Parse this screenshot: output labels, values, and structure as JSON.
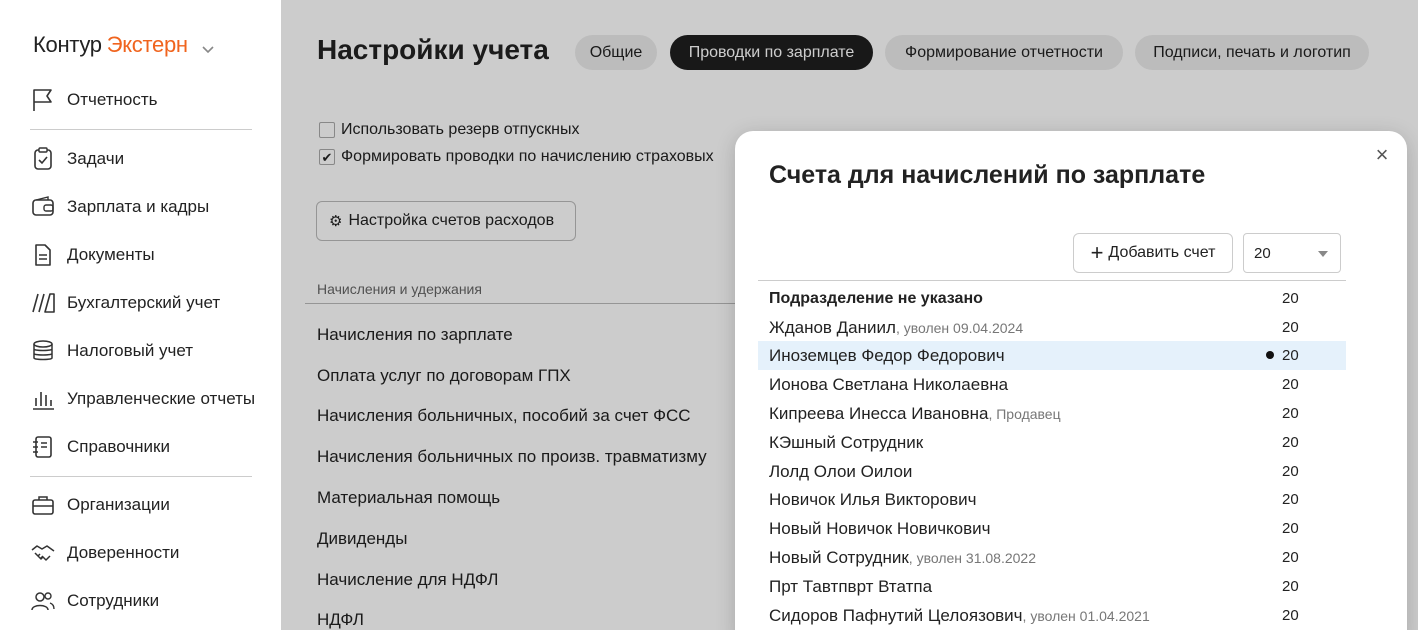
{
  "brand": {
    "part1": "Контур",
    "part2": "Экстерн"
  },
  "sidebar": {
    "items": [
      {
        "label": "Отчетность",
        "icon": "flag-icon"
      },
      {
        "label": "Задачи",
        "icon": "clipboard-check-icon"
      },
      {
        "label": "Зарплата и кадры",
        "icon": "wallet-icon"
      },
      {
        "label": "Документы",
        "icon": "document-icon"
      },
      {
        "label": "Бухгалтерский учет",
        "icon": "accounting-icon"
      },
      {
        "label": "Налоговый учет",
        "icon": "coins-icon"
      },
      {
        "label": "Управленческие отчеты",
        "icon": "bar-chart-icon"
      },
      {
        "label": "Справочники",
        "icon": "notebook-icon"
      },
      {
        "label": "Организации",
        "icon": "briefcase-icon"
      },
      {
        "label": "Доверенности",
        "icon": "handshake-icon"
      },
      {
        "label": "Сотрудники",
        "icon": "users-icon"
      }
    ]
  },
  "main": {
    "title": "Настройки учета",
    "tabs": [
      {
        "label": "Общие"
      },
      {
        "label": "Проводки по зарплате",
        "active": true
      },
      {
        "label": "Формирование отчетности"
      },
      {
        "label": "Подписи, печать и логотип"
      }
    ],
    "checkboxes": [
      {
        "label": "Использовать резерв отпускных",
        "checked": false
      },
      {
        "label": "Формировать проводки по начислению страховых",
        "checked": true
      }
    ],
    "settings_button": "Настройка счетов расходов",
    "column_header": "Начисления и удержания",
    "accruals": [
      "Начисления по зарплате",
      "Оплата услуг по договорам ГПХ",
      "Начисления больничных, пособий за счет ФСС",
      "Начисления больничных по произв. травматизму",
      "Материальная помощь",
      "Дивиденды",
      "Начисление для НДФЛ",
      "НДФЛ"
    ]
  },
  "modal": {
    "title": "Счета для начислений по зарплате",
    "add_button": "Добавить счет",
    "select_value": "20",
    "rows": [
      {
        "name": "Подразделение не указано",
        "note": "",
        "account": "20",
        "bold": true
      },
      {
        "name": "Жданов Даниил",
        "note": ", уволен 09.04.2024",
        "account": "20"
      },
      {
        "name": "Иноземцев Федор Федорович",
        "note": "",
        "account": "20",
        "selected": true
      },
      {
        "name": "Ионова Светлана Николаевна",
        "note": "",
        "account": "20"
      },
      {
        "name": "Кипреева Инесса Ивановна",
        "note": ", Продавец",
        "account": "20"
      },
      {
        "name": "КЭшный Сотрудник",
        "note": "",
        "account": "20"
      },
      {
        "name": "Лолд Олои Оилои",
        "note": "",
        "account": "20"
      },
      {
        "name": "Новичок Илья Викторович",
        "note": "",
        "account": "20"
      },
      {
        "name": "Новый Новичок Новичкович",
        "note": "",
        "account": "20"
      },
      {
        "name": "Новый Сотрудник",
        "note": ", уволен 31.08.2022",
        "account": "20"
      },
      {
        "name": "Прт Тавтпврт Втатпа",
        "note": "",
        "account": "20"
      },
      {
        "name": "Сидоров Пафнутий Целоязович",
        "note": ", уволен 01.04.2021",
        "account": "20"
      }
    ]
  }
}
